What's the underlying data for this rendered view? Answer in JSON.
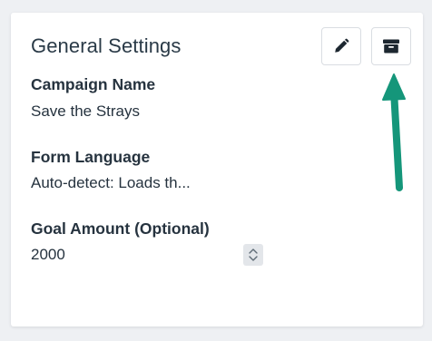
{
  "panel": {
    "title": "General Settings",
    "edit_icon": "pencil-icon",
    "archive_icon": "archive-box-icon"
  },
  "fields": {
    "campaign_name": {
      "label": "Campaign Name",
      "value": "Save the Strays"
    },
    "form_language": {
      "label": "Form Language",
      "value": "Auto-detect: Loads th..."
    },
    "goal_amount": {
      "label": "Goal Amount (Optional)",
      "value": "2000",
      "stepper_icon": "up-down-stepper-icon"
    }
  },
  "annotation": {
    "arrow_color": "#15967a",
    "arrow_icon": "pointer-arrow-icon"
  },
  "colors": {
    "background": "#eef0f3",
    "card": "#ffffff",
    "text": "#26333f"
  }
}
